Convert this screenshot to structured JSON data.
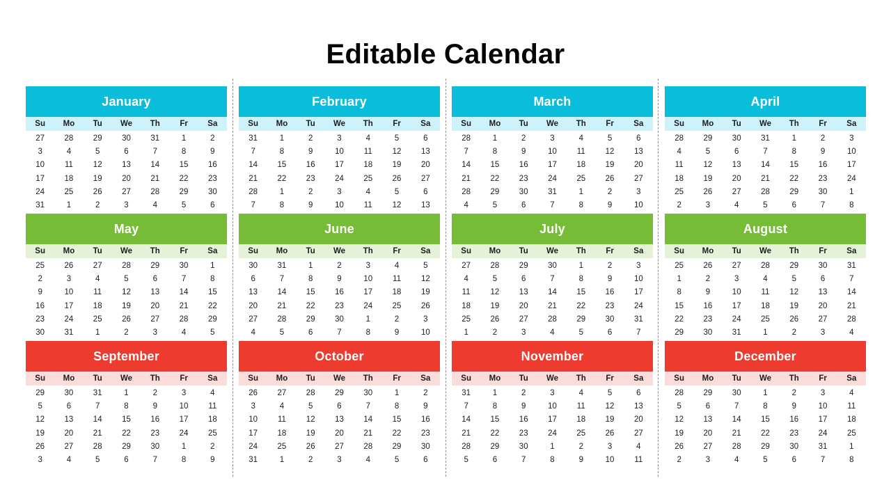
{
  "page": {
    "title": "Editable Calendar"
  },
  "theme": {
    "cyan_header": "#0ABEDB",
    "cyan_weekday": "#CDF2FA",
    "green_header": "#76BC37",
    "green_weekday": "#E6F2D8",
    "red_header": "#EE3B30",
    "red_weekday": "#FBDCDB",
    "title_color": "#050505",
    "day_text": "#1C1C1C",
    "separator_color": "#8F8F8F",
    "background": "#FFFFFF"
  },
  "weekdays": [
    "Su",
    "Mo",
    "Tu",
    "We",
    "Th",
    "Fr",
    "Sa"
  ],
  "months": [
    {
      "name": "January",
      "theme": "cyan",
      "weeks": [
        [
          "27",
          "28",
          "29",
          "30",
          "31",
          "1",
          "2"
        ],
        [
          "3",
          "4",
          "5",
          "6",
          "7",
          "8",
          "9"
        ],
        [
          "10",
          "11",
          "12",
          "13",
          "14",
          "15",
          "16"
        ],
        [
          "17",
          "18",
          "19",
          "20",
          "21",
          "22",
          "23"
        ],
        [
          "24",
          "25",
          "26",
          "27",
          "28",
          "29",
          "30"
        ],
        [
          "31",
          "1",
          "2",
          "3",
          "4",
          "5",
          "6"
        ]
      ]
    },
    {
      "name": "February",
      "theme": "cyan",
      "weeks": [
        [
          "31",
          "1",
          "2",
          "3",
          "4",
          "5",
          "6"
        ],
        [
          "7",
          "8",
          "9",
          "10",
          "11",
          "12",
          "13"
        ],
        [
          "14",
          "15",
          "16",
          "17",
          "18",
          "19",
          "20"
        ],
        [
          "21",
          "22",
          "23",
          "24",
          "25",
          "26",
          "27"
        ],
        [
          "28",
          "1",
          "2",
          "3",
          "4",
          "5",
          "6"
        ],
        [
          "7",
          "8",
          "9",
          "10",
          "11",
          "12",
          "13"
        ]
      ]
    },
    {
      "name": "March",
      "theme": "cyan",
      "weeks": [
        [
          "28",
          "1",
          "2",
          "3",
          "4",
          "5",
          "6"
        ],
        [
          "7",
          "8",
          "9",
          "10",
          "11",
          "12",
          "13"
        ],
        [
          "14",
          "15",
          "16",
          "17",
          "18",
          "19",
          "20"
        ],
        [
          "21",
          "22",
          "23",
          "24",
          "25",
          "26",
          "27"
        ],
        [
          "28",
          "29",
          "30",
          "31",
          "1",
          "2",
          "3"
        ],
        [
          "4",
          "5",
          "6",
          "7",
          "8",
          "9",
          "10"
        ]
      ]
    },
    {
      "name": "April",
      "theme": "cyan",
      "weeks": [
        [
          "28",
          "29",
          "30",
          "31",
          "1",
          "2",
          "3"
        ],
        [
          "4",
          "5",
          "6",
          "7",
          "8",
          "9",
          "10"
        ],
        [
          "11",
          "12",
          "13",
          "14",
          "15",
          "16",
          "17"
        ],
        [
          "18",
          "19",
          "20",
          "21",
          "22",
          "23",
          "24"
        ],
        [
          "25",
          "26",
          "27",
          "28",
          "29",
          "30",
          "1"
        ],
        [
          "2",
          "3",
          "4",
          "5",
          "6",
          "7",
          "8"
        ]
      ]
    },
    {
      "name": "May",
      "theme": "green",
      "weeks": [
        [
          "25",
          "26",
          "27",
          "28",
          "29",
          "30",
          "1"
        ],
        [
          "2",
          "3",
          "4",
          "5",
          "6",
          "7",
          "8"
        ],
        [
          "9",
          "10",
          "11",
          "12",
          "13",
          "14",
          "15"
        ],
        [
          "16",
          "17",
          "18",
          "19",
          "20",
          "21",
          "22"
        ],
        [
          "23",
          "24",
          "25",
          "26",
          "27",
          "28",
          "29"
        ],
        [
          "30",
          "31",
          "1",
          "2",
          "3",
          "4",
          "5"
        ]
      ]
    },
    {
      "name": "June",
      "theme": "green",
      "weeks": [
        [
          "30",
          "31",
          "1",
          "2",
          "3",
          "4",
          "5"
        ],
        [
          "6",
          "7",
          "8",
          "9",
          "10",
          "11",
          "12"
        ],
        [
          "13",
          "14",
          "15",
          "16",
          "17",
          "18",
          "19"
        ],
        [
          "20",
          "21",
          "22",
          "23",
          "24",
          "25",
          "26"
        ],
        [
          "27",
          "28",
          "29",
          "30",
          "1",
          "2",
          "3"
        ],
        [
          "4",
          "5",
          "6",
          "7",
          "8",
          "9",
          "10"
        ]
      ]
    },
    {
      "name": "July",
      "theme": "green",
      "weeks": [
        [
          "27",
          "28",
          "29",
          "30",
          "1",
          "2",
          "3"
        ],
        [
          "4",
          "5",
          "6",
          "7",
          "8",
          "9",
          "10"
        ],
        [
          "11",
          "12",
          "13",
          "14",
          "15",
          "16",
          "17"
        ],
        [
          "18",
          "19",
          "20",
          "21",
          "22",
          "23",
          "24"
        ],
        [
          "25",
          "26",
          "27",
          "28",
          "29",
          "30",
          "31"
        ],
        [
          "1",
          "2",
          "3",
          "4",
          "5",
          "6",
          "7"
        ]
      ]
    },
    {
      "name": "August",
      "theme": "green",
      "weeks": [
        [
          "25",
          "26",
          "27",
          "28",
          "29",
          "30",
          "31"
        ],
        [
          "1",
          "2",
          "3",
          "4",
          "5",
          "6",
          "7"
        ],
        [
          "8",
          "9",
          "10",
          "11",
          "12",
          "13",
          "14"
        ],
        [
          "15",
          "16",
          "17",
          "18",
          "19",
          "20",
          "21"
        ],
        [
          "22",
          "23",
          "24",
          "25",
          "26",
          "27",
          "28"
        ],
        [
          "29",
          "30",
          "31",
          "1",
          "2",
          "3",
          "4"
        ]
      ]
    },
    {
      "name": "September",
      "theme": "red",
      "weeks": [
        [
          "29",
          "30",
          "31",
          "1",
          "2",
          "3",
          "4"
        ],
        [
          "5",
          "6",
          "7",
          "8",
          "9",
          "10",
          "11"
        ],
        [
          "12",
          "13",
          "14",
          "15",
          "16",
          "17",
          "18"
        ],
        [
          "19",
          "20",
          "21",
          "22",
          "23",
          "24",
          "25"
        ],
        [
          "26",
          "27",
          "28",
          "29",
          "30",
          "1",
          "2"
        ],
        [
          "3",
          "4",
          "5",
          "6",
          "7",
          "8",
          "9"
        ]
      ]
    },
    {
      "name": "October",
      "theme": "red",
      "weeks": [
        [
          "26",
          "27",
          "28",
          "29",
          "30",
          "1",
          "2"
        ],
        [
          "3",
          "4",
          "5",
          "6",
          "7",
          "8",
          "9"
        ],
        [
          "10",
          "11",
          "12",
          "13",
          "14",
          "15",
          "16"
        ],
        [
          "17",
          "18",
          "19",
          "20",
          "21",
          "22",
          "23"
        ],
        [
          "24",
          "25",
          "26",
          "27",
          "28",
          "29",
          "30"
        ],
        [
          "31",
          "1",
          "2",
          "3",
          "4",
          "5",
          "6"
        ]
      ]
    },
    {
      "name": "November",
      "theme": "red",
      "weeks": [
        [
          "31",
          "1",
          "2",
          "3",
          "4",
          "5",
          "6"
        ],
        [
          "7",
          "8",
          "9",
          "10",
          "11",
          "12",
          "13"
        ],
        [
          "14",
          "15",
          "16",
          "17",
          "18",
          "19",
          "20"
        ],
        [
          "21",
          "22",
          "23",
          "24",
          "25",
          "26",
          "27"
        ],
        [
          "28",
          "29",
          "30",
          "1",
          "2",
          "3",
          "4"
        ],
        [
          "5",
          "6",
          "7",
          "8",
          "9",
          "10",
          "11"
        ]
      ]
    },
    {
      "name": "December",
      "theme": "red",
      "weeks": [
        [
          "28",
          "29",
          "30",
          "1",
          "2",
          "3",
          "4"
        ],
        [
          "5",
          "6",
          "7",
          "8",
          "9",
          "10",
          "11"
        ],
        [
          "12",
          "13",
          "14",
          "15",
          "16",
          "17",
          "18"
        ],
        [
          "19",
          "20",
          "21",
          "22",
          "23",
          "24",
          "25"
        ],
        [
          "26",
          "27",
          "28",
          "29",
          "30",
          "31",
          "1"
        ],
        [
          "2",
          "3",
          "4",
          "5",
          "6",
          "7",
          "8"
        ]
      ]
    }
  ]
}
